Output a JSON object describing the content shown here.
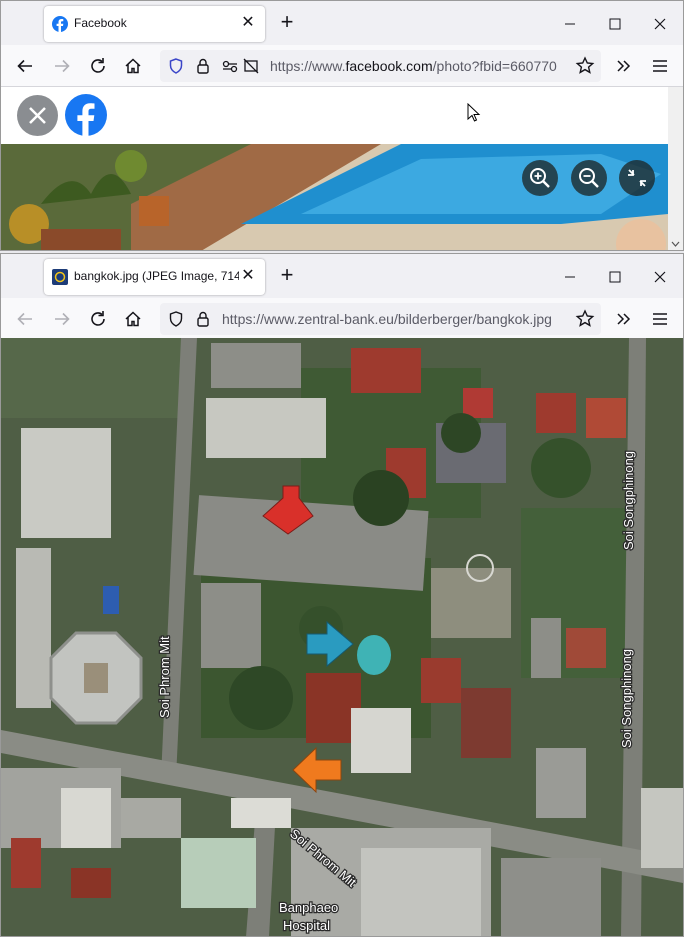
{
  "window1": {
    "tab": {
      "title": "Facebook",
      "icon": "facebook-icon"
    },
    "url": {
      "prefix": "https://www.",
      "domain": "facebook.com",
      "rest": "/photo?fbid=660770"
    },
    "photo_controls": [
      "zoom-in-icon",
      "zoom-out-icon",
      "exit-fullscreen-icon"
    ]
  },
  "window2": {
    "tab": {
      "title": "bangkok.jpg (JPEG Image, 714",
      "icon": "bank-favicon-icon"
    },
    "url": {
      "text": "https://www.zentral-bank.eu/bilderberger/bangkok.jpg"
    },
    "map": {
      "labels": {
        "soi_phrom_mit_vertical": "Soi Phrom Mit",
        "soi_songphinong_upper": "Soi Songphinong",
        "soi_songphinong_lower": "Soi Songphinong",
        "soi_phrom_mit_bottom": "Soi Phrom Mit",
        "banphaeo": "Banphaeo",
        "hospital": "Hospital"
      },
      "arrows": [
        {
          "color": "red",
          "hex": "#d9302a"
        },
        {
          "color": "blue",
          "hex": "#2a9bc0"
        },
        {
          "color": "orange",
          "hex": "#f07a1e"
        }
      ]
    }
  },
  "colors": {
    "facebook_blue": "#1877f2",
    "firefox_accent": "#0060df"
  }
}
